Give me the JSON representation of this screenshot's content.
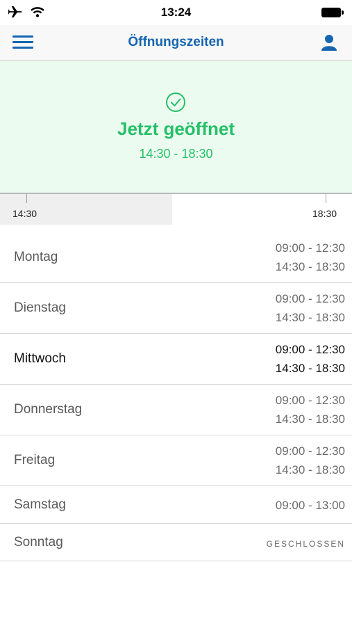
{
  "status_bar": {
    "time": "13:24"
  },
  "nav": {
    "title": "Öffnungszeiten"
  },
  "banner": {
    "status": "Jetzt geöffnet",
    "hours": "14:30 - 18:30"
  },
  "timeline": {
    "start_label": "14:30",
    "end_label": "18:30",
    "progress": 0.49
  },
  "schedule": [
    {
      "day": "Montag",
      "ranges": [
        "09:00 - 12:30",
        "14:30 - 18:30"
      ]
    },
    {
      "day": "Dienstag",
      "ranges": [
        "09:00 - 12:30",
        "14:30 - 18:30"
      ]
    },
    {
      "day": "Mittwoch",
      "ranges": [
        "09:00 - 12:30",
        "14:30 - 18:30"
      ],
      "current": true
    },
    {
      "day": "Donnerstag",
      "ranges": [
        "09:00 - 12:30",
        "14:30 - 18:30"
      ]
    },
    {
      "day": "Freitag",
      "ranges": [
        "09:00 - 12:30",
        "14:30 - 18:30"
      ]
    },
    {
      "day": "Samstag",
      "ranges": [
        "09:00 - 13:00"
      ]
    },
    {
      "day": "Sonntag",
      "ranges": [],
      "closed_label": "GESCHLOSSEN"
    }
  ],
  "colors": {
    "accent": "#1565b0",
    "open_green": "#25c068",
    "banner_bg": "#ecfbf0"
  }
}
